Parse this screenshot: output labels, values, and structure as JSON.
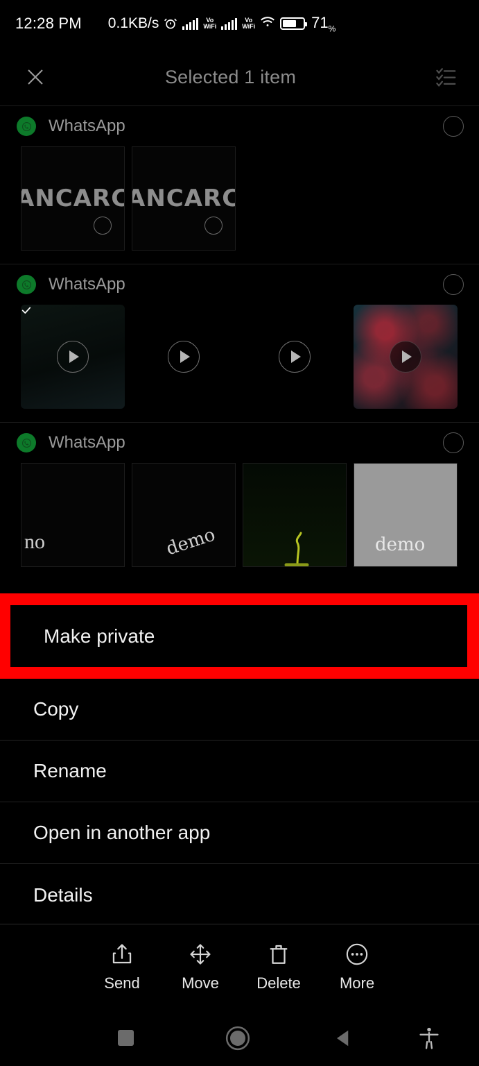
{
  "status_bar": {
    "time": "12:28 PM",
    "network_speed": "0.1KB/s",
    "alarm_icon": "alarm-clock-icon",
    "signal_1_icon": "signal-bars-icon",
    "volte_1_line1": "Vo",
    "volte_1_line2": "WiFi",
    "signal_2_icon": "signal-bars-icon",
    "volte_2_line1": "Vo",
    "volte_2_line2": "WiFi",
    "wifi_icon": "wifi-icon",
    "battery_icon": "battery-icon",
    "battery_percent": "71",
    "battery_percent_symbol": "%"
  },
  "app_bar": {
    "close_icon": "close-icon",
    "title": "Selected 1 item",
    "select_all_icon": "select-all-checklist-icon"
  },
  "groups": [
    {
      "app_icon": "whatsapp-icon",
      "name": "WhatsApp",
      "group_checkbox": "unchecked",
      "items": [
        {
          "kind": "image",
          "label": "ANCARC",
          "checkbox": "unchecked"
        },
        {
          "kind": "image",
          "label": "ANCARC",
          "checkbox": "unchecked"
        }
      ]
    },
    {
      "app_icon": "whatsapp-icon",
      "name": "WhatsApp",
      "group_checkbox": "unchecked",
      "items": [
        {
          "kind": "video",
          "label": "",
          "checkbox": "checked"
        },
        {
          "kind": "video",
          "label": "",
          "checkbox": "unchecked"
        },
        {
          "kind": "video",
          "label": "",
          "checkbox": "unchecked"
        },
        {
          "kind": "video",
          "label": "",
          "checkbox": "unchecked"
        }
      ]
    },
    {
      "app_icon": "whatsapp-icon",
      "name": "WhatsApp",
      "group_checkbox": "unchecked",
      "items": [
        {
          "kind": "image",
          "label": "no",
          "checkbox": "unchecked"
        },
        {
          "kind": "image",
          "label": "demo",
          "checkbox": "unchecked"
        },
        {
          "kind": "image",
          "label": "",
          "checkbox": "unchecked"
        },
        {
          "kind": "image",
          "label": "demo",
          "checkbox": "unchecked"
        }
      ]
    }
  ],
  "context_menu": {
    "highlighted_index": 0,
    "highlight_color": "#ff0000",
    "items": [
      {
        "label": "Make private"
      },
      {
        "label": "Copy"
      },
      {
        "label": "Rename"
      },
      {
        "label": "Open in another app"
      },
      {
        "label": "Details"
      }
    ]
  },
  "action_bar": {
    "actions": [
      {
        "label": "Send",
        "icon": "share-upload-icon"
      },
      {
        "label": "Move",
        "icon": "move-arrows-icon"
      },
      {
        "label": "Delete",
        "icon": "trash-icon"
      },
      {
        "label": "More",
        "icon": "more-ellipsis-icon"
      }
    ]
  },
  "nav_bar": {
    "recents_icon": "square-recents-icon",
    "home_icon": "circle-home-icon",
    "back_icon": "triangle-back-icon",
    "accessibility_icon": "accessibility-person-icon"
  },
  "colors": {
    "background": "#000000",
    "highlight": "#ff0000",
    "selected_check": "#0c72c0",
    "whatsapp_green": "#0d7a2a",
    "title_gray": "#8c8c8c"
  }
}
